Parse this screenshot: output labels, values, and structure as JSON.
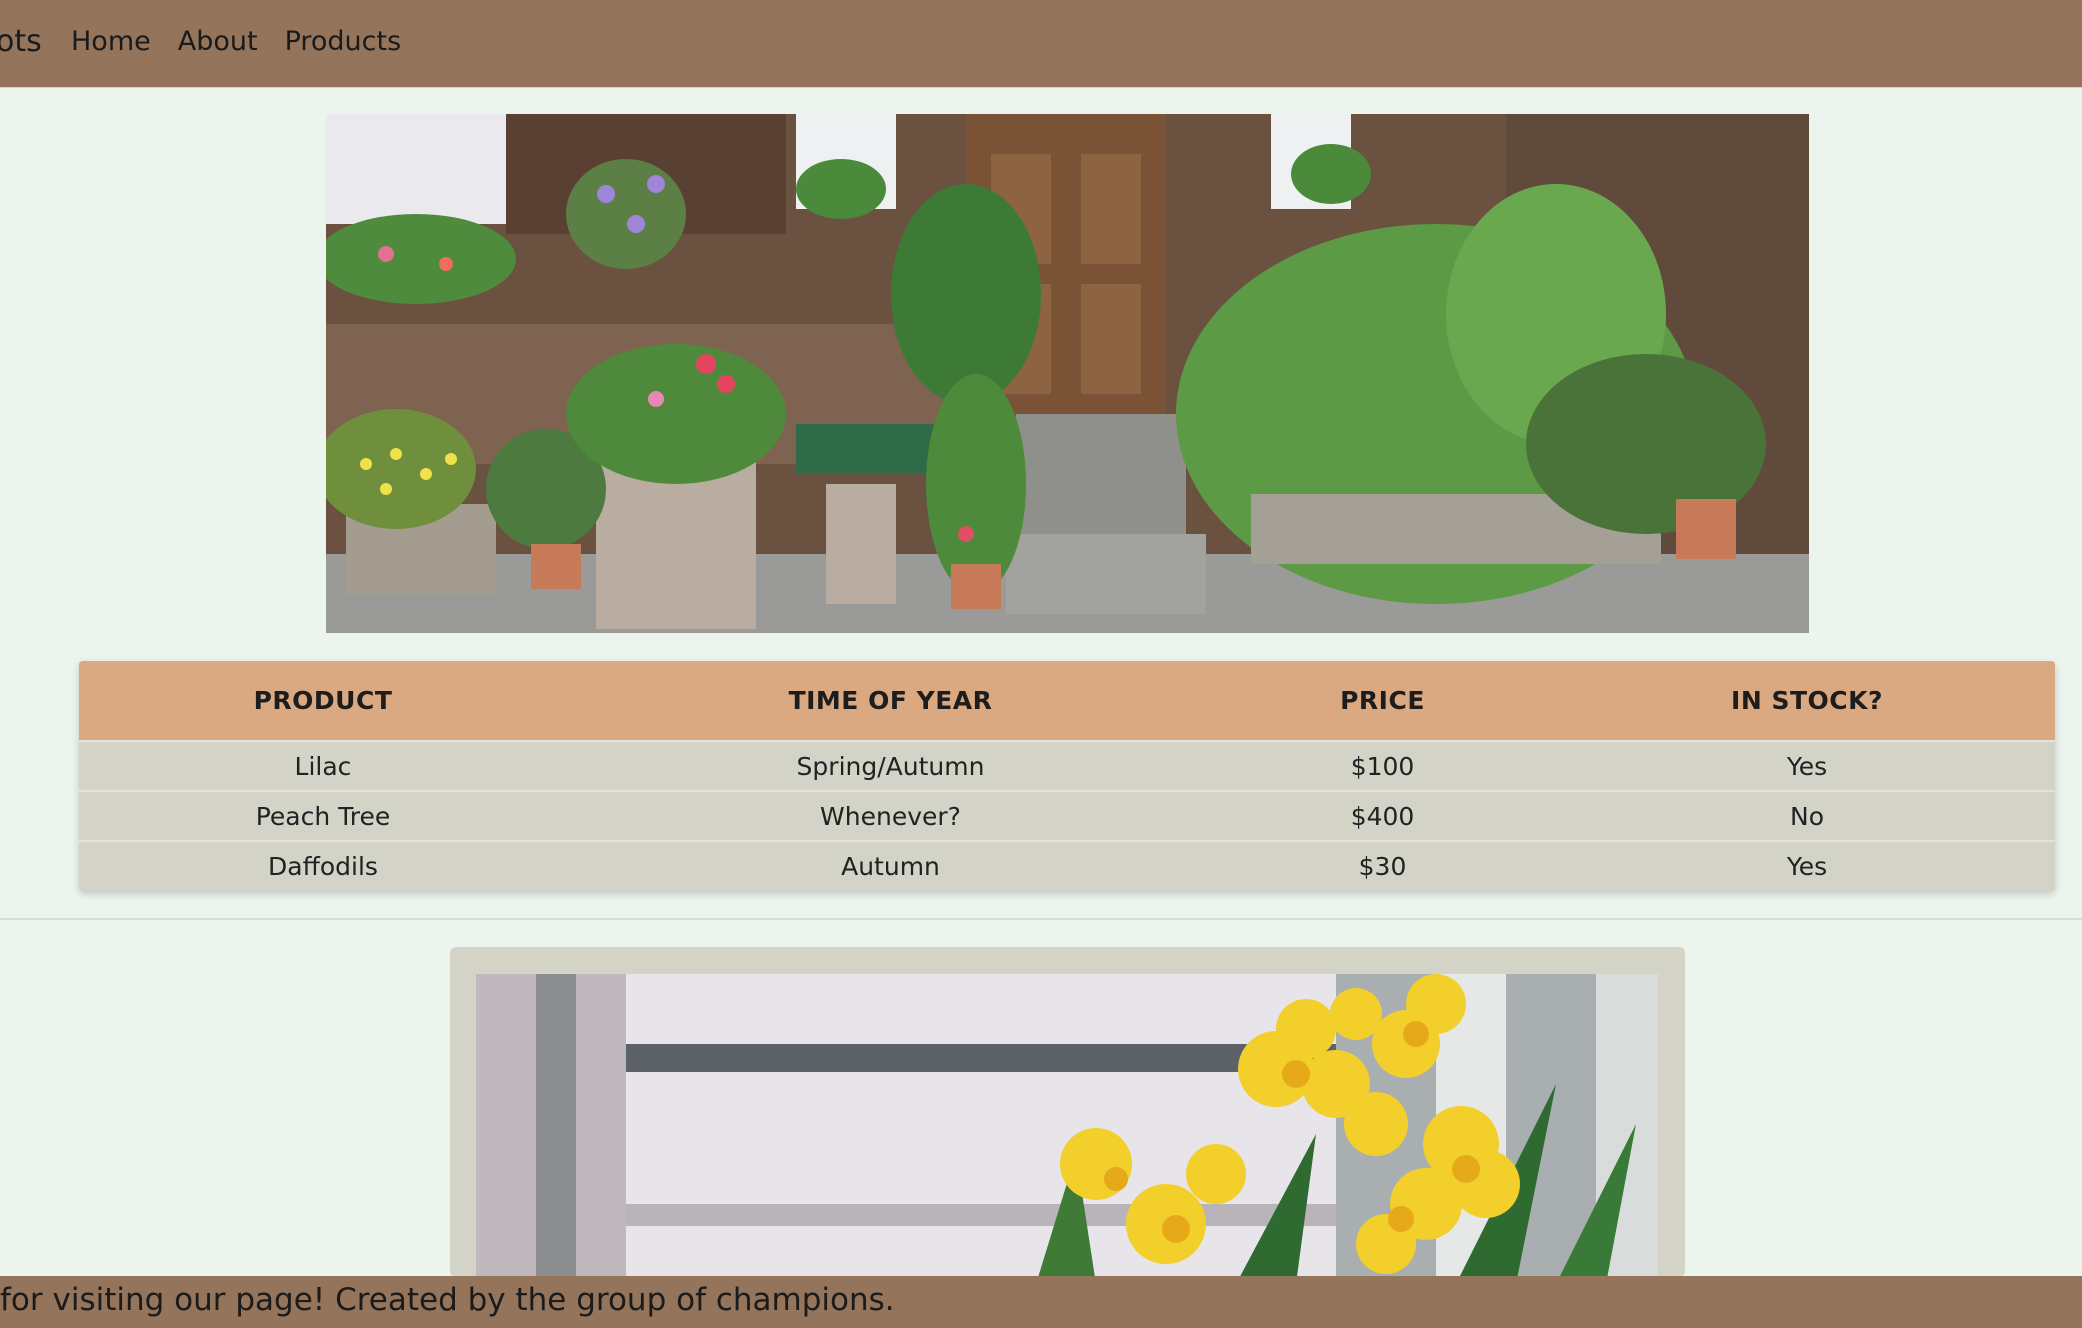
{
  "nav": {
    "brand": "ots",
    "links": [
      "Home",
      "About",
      "Products"
    ]
  },
  "products_table": {
    "headers": [
      "PRODUCT",
      "TIME OF YEAR",
      "PRICE",
      "IN STOCK?"
    ],
    "rows": [
      [
        "Lilac",
        "Spring/Autumn",
        "$100",
        "Yes"
      ],
      [
        "Peach Tree",
        "Whenever?",
        "$400",
        "No"
      ],
      [
        "Daffodils",
        "Autumn",
        "$30",
        "Yes"
      ]
    ]
  },
  "footer": {
    "text": "for visiting our page! Created by the group of champions."
  },
  "colors": {
    "nav_bg": "#94755c",
    "page_bg": "#ecf4ee",
    "table_header_bg": "#dba981",
    "table_body_bg": "#d3d3c8"
  }
}
